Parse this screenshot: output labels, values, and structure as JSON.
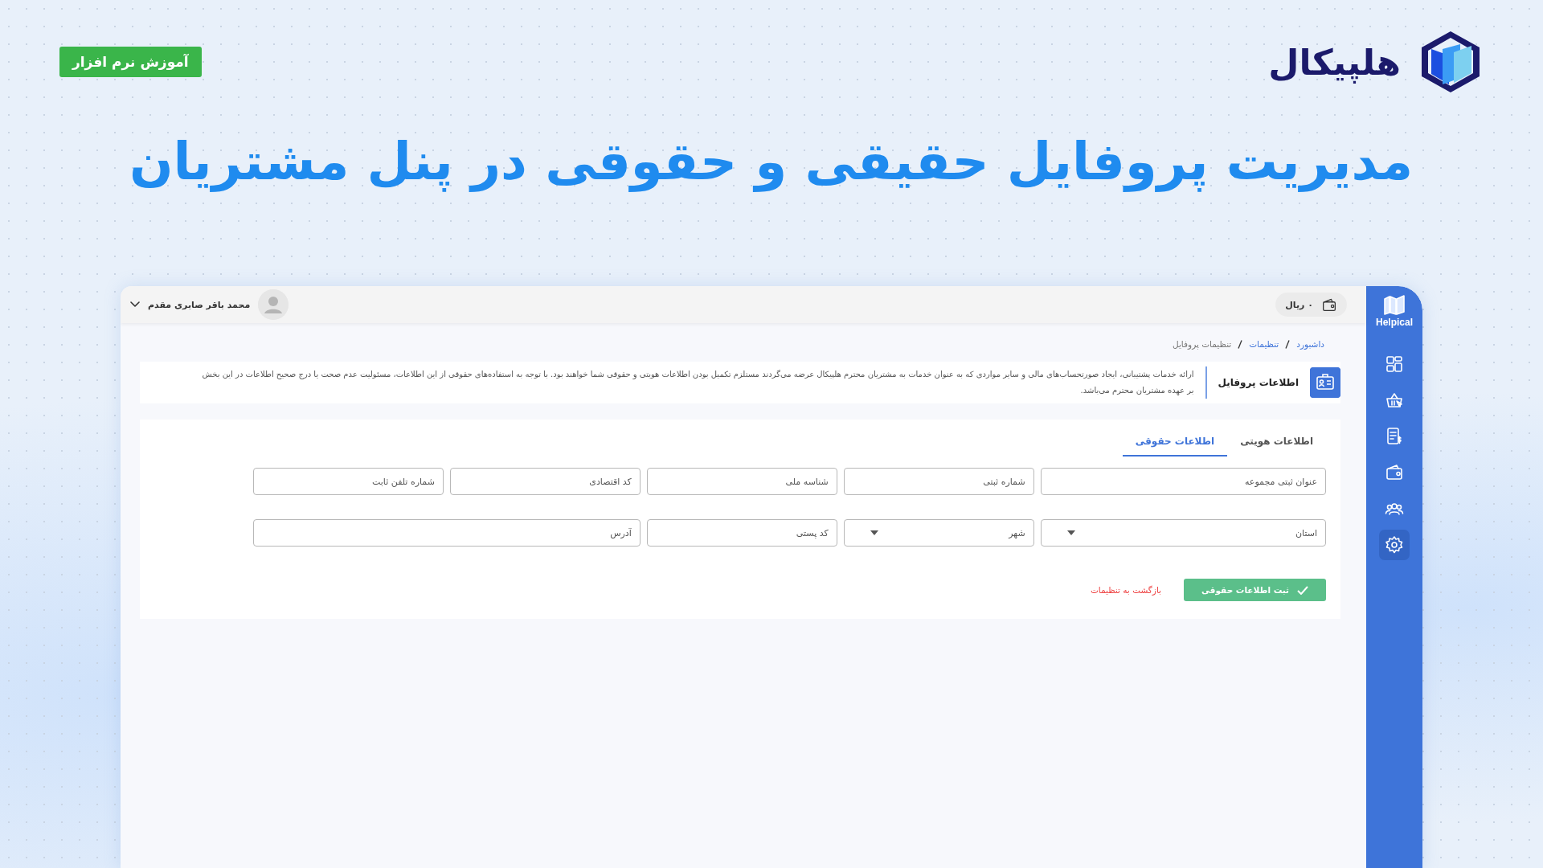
{
  "header": {
    "logo_text": "هلپیکال",
    "badge": "آموزش نرم افزار",
    "title": "مدیریت پروفایل حقیقی و حقوقی در پنل مشتریان"
  },
  "sidebar": {
    "brand": "Helpical",
    "items": [
      {
        "kind": "dashboard",
        "selected": false
      },
      {
        "kind": "basket",
        "selected": false
      },
      {
        "kind": "invoice",
        "selected": false
      },
      {
        "kind": "wallet",
        "selected": false
      },
      {
        "kind": "users",
        "selected": false
      },
      {
        "kind": "settings",
        "selected": true
      }
    ]
  },
  "topbar": {
    "balance": "۰ ریال",
    "user_name": "محمد باقر صابری مقدم"
  },
  "breadcrumb": [
    {
      "label": "داشبورد",
      "current": false
    },
    {
      "label": "تنظیمات",
      "current": false
    },
    {
      "label": "تنظیمات پروفایل",
      "current": true
    }
  ],
  "info": {
    "title": "اطلاعات پروفایل",
    "text": "ارائه خدمات پشتیبانی، ایجاد صورتحساب‌های مالی و سایر مواردی که به عنوان خدمات به مشتریان محترم هلپیکال عرضه می‌گردند مستلزم تکمیل بودن اطلاعات هویتی و حقوقی شما خواهند بود. با توجه به استفاده‌های حقوقی از این اطلاعات، مسئولیت عدم صحت یا درج صحیح اطلاعات در این بخش بر عهده مشتریان محترم می‌باشد."
  },
  "tabs": [
    {
      "label": "اطلاعات هویتی",
      "selected": false
    },
    {
      "label": "اطلاعات حقوقی",
      "selected": true
    }
  ],
  "form_rows": [
    [
      {
        "kind": "text",
        "placeholder": "عنوان ثبتی مجموعه"
      },
      {
        "kind": "text",
        "placeholder": "شماره ثبتی"
      },
      {
        "kind": "text",
        "placeholder": "شناسه ملی"
      },
      {
        "kind": "text",
        "placeholder": "کد اقتصادی"
      },
      {
        "kind": "text",
        "placeholder": "شماره تلفن ثابت"
      }
    ],
    [
      {
        "kind": "select",
        "placeholder": "استان"
      },
      {
        "kind": "select",
        "placeholder": "شهر"
      },
      {
        "kind": "text",
        "placeholder": "کد پستی"
      },
      {
        "kind": "text",
        "placeholder": "آدرس"
      }
    ]
  ],
  "submit_button": "ثبت اطلاعات حقوقی",
  "back_link": "بازگشت به تنظیمات"
}
